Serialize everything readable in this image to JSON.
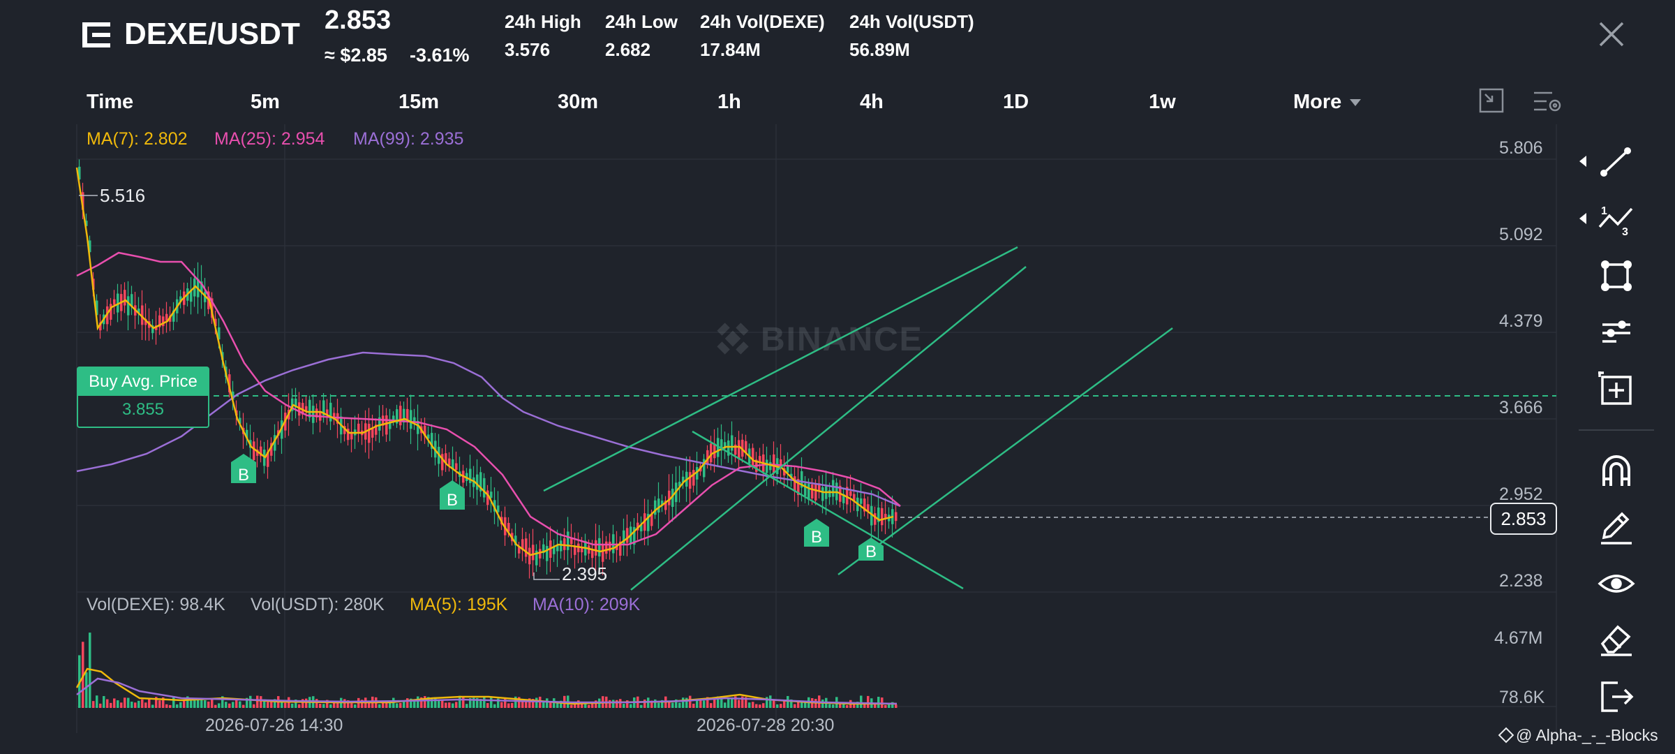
{
  "header": {
    "menu_icon": "menu-icon",
    "pair": "DEXE/USDT",
    "price": "2.853",
    "usd_price": "≈ $2.85",
    "change": "-3.61%",
    "stats": [
      {
        "label": "24h High",
        "value": "3.576"
      },
      {
        "label": "24h Low",
        "value": "2.682"
      },
      {
        "label": "24h Vol(DEXE)",
        "value": "17.84M"
      },
      {
        "label": "24h Vol(USDT)",
        "value": "56.89M"
      }
    ],
    "close_icon": "close-icon"
  },
  "timeframes": [
    "Time",
    "5m",
    "15m",
    "30m",
    "1h",
    "4h",
    "1D",
    "1w",
    "More"
  ],
  "toolbar_icons": [
    "fullscreen-toggle-icon",
    "chart-settings-icon"
  ],
  "ma_legend": [
    {
      "label": "MA(7): 2.802",
      "color": "#f0b90b"
    },
    {
      "label": "MA(25): 2.954",
      "color": "#e84fae"
    },
    {
      "label": "MA(99): 2.935",
      "color": "#9b6fd6"
    }
  ],
  "price_axis": [
    "5.806",
    "5.092",
    "4.379",
    "3.666",
    "2.952",
    "2.238"
  ],
  "current_price_tag": "2.853",
  "high_marker": "5.516",
  "low_marker": "2.395",
  "buy_avg": {
    "label": "Buy Avg. Price",
    "value": "3.855"
  },
  "buy_marker_label": "B",
  "watermark": "BINANCE",
  "volume_legend": [
    {
      "label": "Vol(DEXE): 98.4K",
      "color": "#b7bdc6"
    },
    {
      "label": "Vol(USDT): 280K",
      "color": "#b7bdc6"
    },
    {
      "label": "MA(5): 195K",
      "color": "#f0b90b"
    },
    {
      "label": "MA(10): 209K",
      "color": "#9b6fd6"
    }
  ],
  "volume_axis": [
    "4.67M",
    "78.6K"
  ],
  "time_axis": [
    "2026-07-26 14:30",
    "2026-07-28 20:30"
  ],
  "side_tools": [
    "trend-line-icon",
    "fib-icon",
    "shape-icon",
    "settings-sliders-icon",
    "add-frame-icon",
    "magnet-icon",
    "pencil-icon",
    "eye-icon",
    "eraser-icon",
    "exit-icon"
  ],
  "footer_credit": "@ Alpha-_-_-Blocks",
  "colors": {
    "up": "#2ebd85",
    "down": "#f6465d",
    "bg": "#1f232b",
    "accent": "#2ebd85"
  }
}
